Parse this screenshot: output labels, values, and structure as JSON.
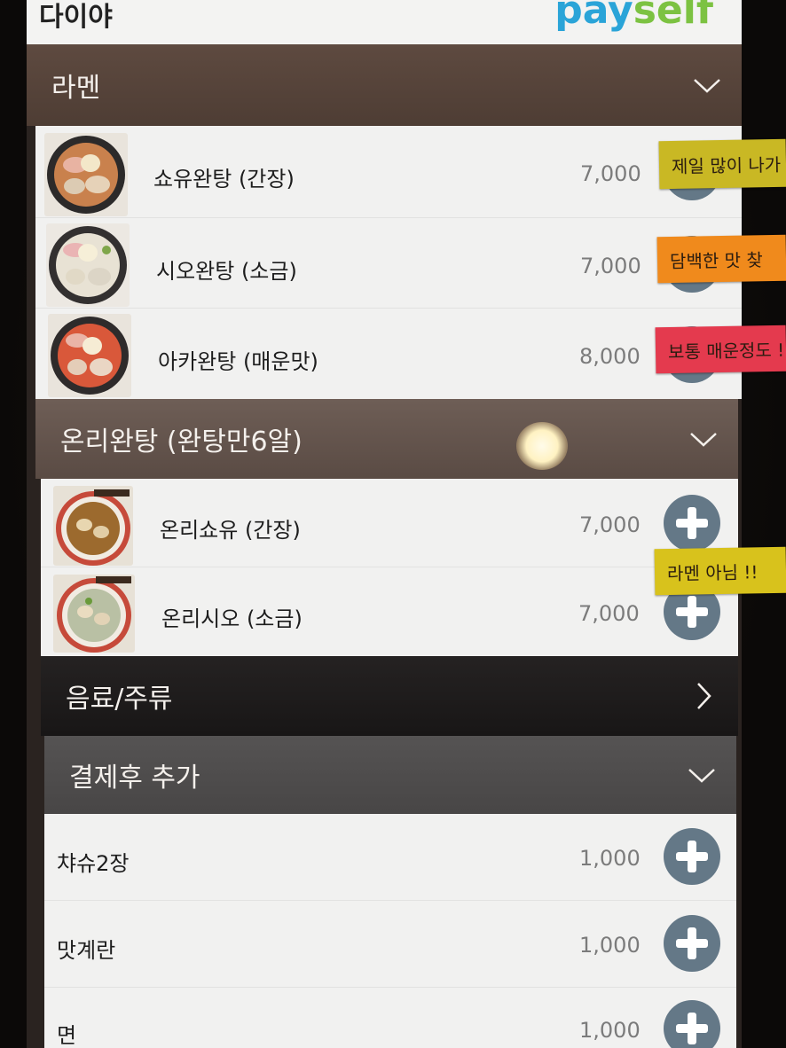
{
  "header": {
    "store_name": "다이야",
    "logo_pay": "pay",
    "logo_self": "self"
  },
  "categories": {
    "ramen": {
      "label": "라멘"
    },
    "onri": {
      "label": "온리완탕 (완탕만6알)"
    },
    "drinks": {
      "label": "음료/주류"
    },
    "addons": {
      "label": "결제후 추가"
    }
  },
  "ramen_items": [
    {
      "name": "쇼유완탕 (간장)",
      "price": "7,000"
    },
    {
      "name": "시오완탕 (소금)",
      "price": "7,000"
    },
    {
      "name": "아카완탕 (매운맛)",
      "price": "8,000"
    }
  ],
  "onri_items": [
    {
      "name": "온리쇼유 (간장)",
      "price": "7,000"
    },
    {
      "name": "온리시오 (소금)",
      "price": "7,000"
    }
  ],
  "addon_items": [
    {
      "name": "챠슈2장",
      "price": "1,000"
    },
    {
      "name": "맛계란",
      "price": "1,000"
    },
    {
      "name": "면",
      "price": "1,000"
    }
  ],
  "sticky_notes": [
    {
      "text": "제일 많이 나가",
      "color": "#c9b824"
    },
    {
      "text": "담백한 맛 찾",
      "color": "#f08a1c"
    },
    {
      "text": "보통 매운정도 !!",
      "color": "#e43a4e"
    },
    {
      "text": "라멘 아님 !!",
      "color": "#d8c21c"
    }
  ],
  "colors": {
    "ramen_header": "#5a463c",
    "onri_header": "#6a5a52",
    "drinks_header": "#1e1c1c",
    "addons_header": "#4f4d4d",
    "plus_button": "#647887",
    "logo_pay": "#2aa4d8",
    "logo_self": "#7cc242"
  }
}
